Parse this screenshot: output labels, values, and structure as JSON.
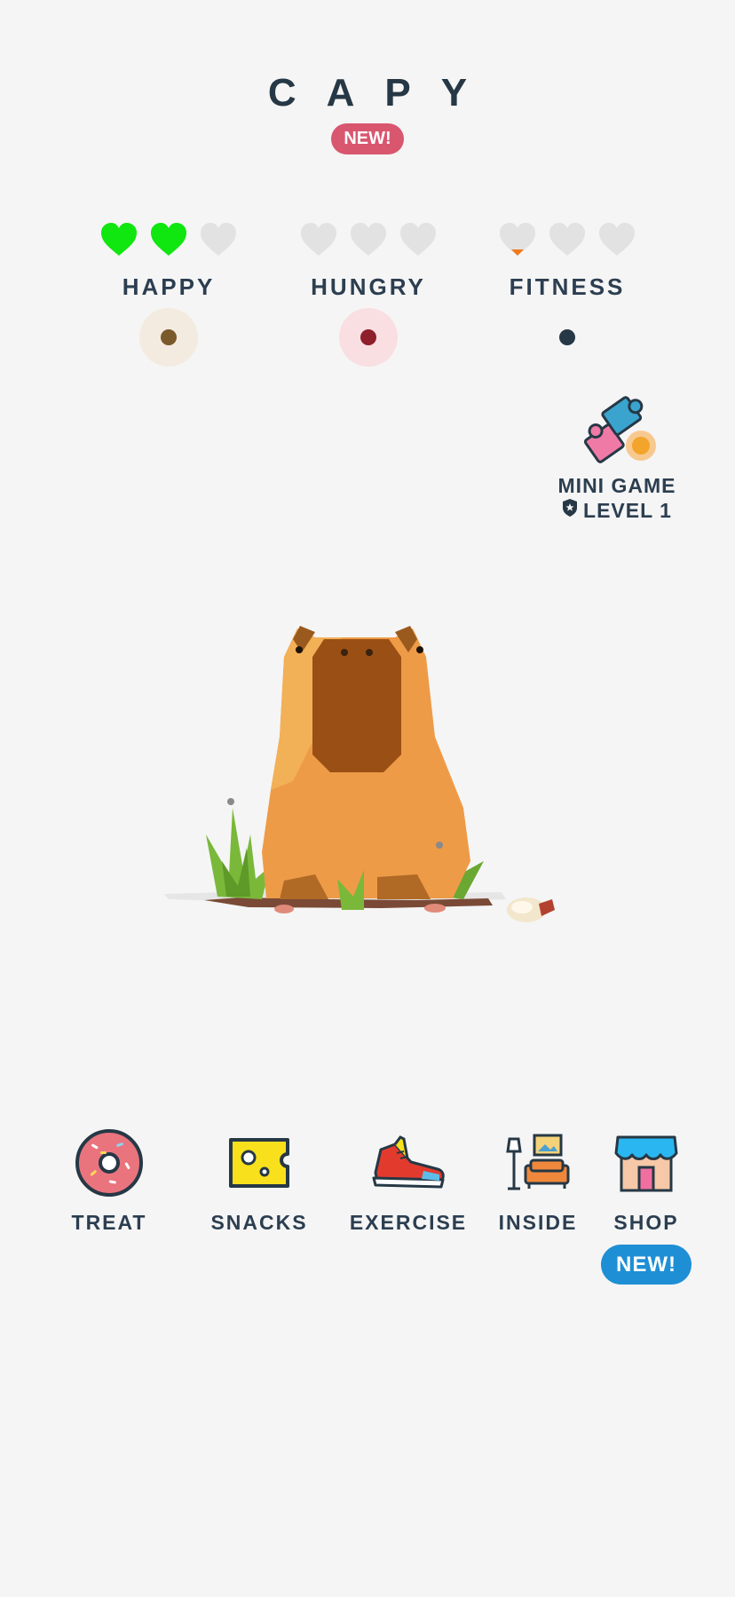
{
  "header": {
    "title": "CAPY",
    "badge": "NEW!"
  },
  "stats": [
    {
      "label": "HAPPY",
      "hearts_filled": 2,
      "hearts_total": 3,
      "dot_color": "#7a5a2a",
      "halo_color": "#f4ebe0"
    },
    {
      "label": "HUNGRY",
      "hearts_filled": 0,
      "hearts_total": 3,
      "dot_color": "#8e1f2b",
      "halo_color": "#f9dfe2"
    },
    {
      "label": "FITNESS",
      "hearts_filled": 0,
      "hearts_total": 3,
      "hearts_partial": 0.1,
      "dot_color": "#263845",
      "halo_color": "#f5f5f5"
    }
  ],
  "colors": {
    "heart_filled": "#10e610",
    "heart_empty": "#e2e2e2",
    "heart_partial": "#f07a1a",
    "new_badge": "#d9566f",
    "shop_badge": "#1e8fd5"
  },
  "minigame": {
    "label": "MINI GAME",
    "level": "LEVEL 1",
    "icon": "puzzle-icon"
  },
  "actions": [
    {
      "label": "TREAT",
      "icon": "donut-icon"
    },
    {
      "label": "SNACKS",
      "icon": "cheese-icon"
    },
    {
      "label": "EXERCISE",
      "icon": "sneaker-icon"
    },
    {
      "label": "INSIDE",
      "icon": "living-room-icon"
    },
    {
      "label": "SHOP",
      "icon": "shop-icon",
      "badge": "NEW!"
    }
  ]
}
